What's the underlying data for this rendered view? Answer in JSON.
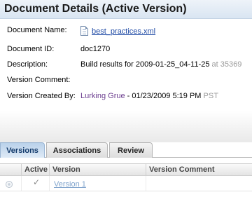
{
  "header": {
    "title": "Document Details (Active Version)"
  },
  "details": {
    "name_label": "Document Name:",
    "name_value": "best_practices.xml",
    "id_label": "Document ID:",
    "id_value": "doc1270",
    "desc_label": "Description:",
    "desc_value": "Build results for 2009-01-25_04-11-25",
    "desc_at": "at 35369",
    "comment_label": "Version Comment:",
    "comment_value": "",
    "created_label": "Version Created By:",
    "created_user": "Lurking Grue",
    "created_date": "- 01/23/2009 5:19 PM",
    "created_tz": "PST"
  },
  "tabs": [
    {
      "label": "Versions",
      "active": true
    },
    {
      "label": "Associations",
      "active": false
    },
    {
      "label": "Review",
      "active": false
    }
  ],
  "grid": {
    "columns": [
      "",
      "Active",
      "Version",
      "Version Comment"
    ],
    "rows": [
      {
        "active_mark": "✓",
        "version": "Version 1",
        "comment": ""
      }
    ]
  },
  "colors": {
    "accent": "#1f4aa5",
    "user": "#6b3d8f",
    "tab_active": "#b9d1ea"
  },
  "icons": {
    "document": "document-icon",
    "check": "check-icon",
    "radio": "radio-button"
  }
}
